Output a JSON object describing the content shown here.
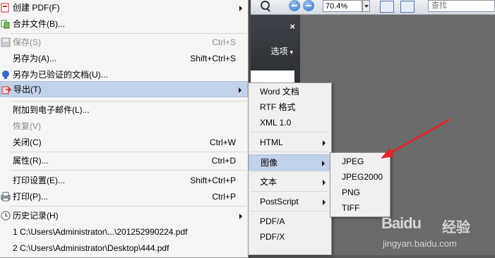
{
  "toolbar": {
    "zoom_value": "70.4%",
    "find_placeholder": "查找"
  },
  "panel": {
    "close_label": "×",
    "options_label": "选项"
  },
  "file_menu": {
    "items": [
      {
        "label": "创建 PDF(F)",
        "shortcut": "",
        "submenu": true,
        "disabled": false,
        "icon": "create-pdf-icon"
      },
      {
        "label": "合并文件(B)...",
        "shortcut": "",
        "submenu": false,
        "disabled": false,
        "icon": "combine-files-icon"
      },
      {
        "label": "保存(S)",
        "shortcut": "Ctrl+S",
        "submenu": false,
        "disabled": true,
        "icon": "save-icon"
      },
      {
        "label": "另存为(A)...",
        "shortcut": "Shift+Ctrl+S",
        "submenu": false,
        "disabled": false,
        "icon": ""
      },
      {
        "label": "另存为已验证的文档(U)...",
        "shortcut": "",
        "submenu": false,
        "disabled": false,
        "icon": "certified-doc-icon"
      },
      {
        "label": "导出(T)",
        "shortcut": "",
        "submenu": true,
        "disabled": false,
        "icon": "export-icon"
      },
      {
        "label": "附加到电子邮件(L)...",
        "shortcut": "",
        "submenu": false,
        "disabled": false,
        "icon": ""
      },
      {
        "label": "恢复(V)",
        "shortcut": "",
        "submenu": false,
        "disabled": true,
        "icon": ""
      },
      {
        "label": "关闭(C)",
        "shortcut": "Ctrl+W",
        "submenu": false,
        "disabled": false,
        "icon": ""
      },
      {
        "label": "属性(R)...",
        "shortcut": "Ctrl+D",
        "submenu": false,
        "disabled": false,
        "icon": ""
      },
      {
        "label": "打印设置(E)...",
        "shortcut": "Shift+Ctrl+P",
        "submenu": false,
        "disabled": false,
        "icon": ""
      },
      {
        "label": "打印(P)...",
        "shortcut": "Ctrl+P",
        "submenu": false,
        "disabled": false,
        "icon": "print-icon"
      },
      {
        "label": "历史记录(H)",
        "shortcut": "",
        "submenu": true,
        "disabled": false,
        "icon": "history-icon"
      },
      {
        "label": "1 C:\\Users\\Administrator\\...\\201252990224.pdf",
        "shortcut": "",
        "submenu": false,
        "disabled": false,
        "icon": ""
      },
      {
        "label": "2 C:\\Users\\Administrator\\Desktop\\444.pdf",
        "shortcut": "",
        "submenu": false,
        "disabled": false,
        "icon": ""
      }
    ]
  },
  "export_menu": {
    "items": [
      {
        "label": "Word 文档",
        "submenu": false
      },
      {
        "label": "RTF 格式",
        "submenu": false
      },
      {
        "label": "XML 1.0",
        "submenu": false
      },
      {
        "label": "HTML",
        "submenu": true
      },
      {
        "label": "图像",
        "submenu": true
      },
      {
        "label": "文本",
        "submenu": true
      },
      {
        "label": "PostScript",
        "submenu": true
      },
      {
        "label": "PDF/A",
        "submenu": false
      },
      {
        "label": "PDF/X",
        "submenu": false
      }
    ]
  },
  "image_menu": {
    "items": [
      {
        "label": "JPEG"
      },
      {
        "label": "JPEG2000"
      },
      {
        "label": "PNG"
      },
      {
        "label": "TIFF"
      }
    ]
  },
  "watermark": {
    "logo": "Baidu",
    "text": "经验",
    "url": "jingyan.baidu.com"
  },
  "colors": {
    "highlight": "#c1d2ea",
    "annotation_arrow": "#e0262b"
  }
}
